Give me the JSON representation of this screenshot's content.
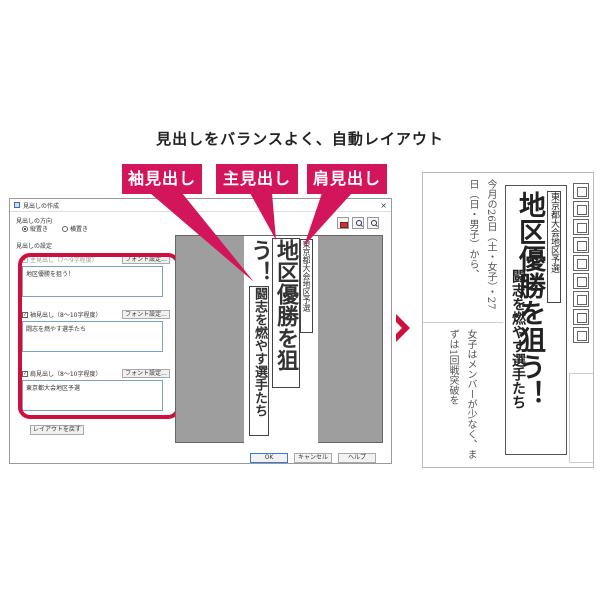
{
  "headline": "見出しをバランスよく、自動レイアウト",
  "tags": {
    "sode": "袖見出し",
    "shu": "主見出し",
    "kata": "肩見出し"
  },
  "dialog": {
    "title": "見出しの作成",
    "close": "×",
    "direction_label": "見出しの方向",
    "radio_vertical": "縦置き",
    "radio_horizontal": "横置き",
    "settings_label": "見出しの設定",
    "main_label": "主見出し（7〜9字程度）",
    "main_value": "地区優勝を狙う！",
    "sode_label": "袖見出し（8〜10字程度）",
    "sode_value": "闘志を燃やす選手たち",
    "kata_label": "肩見出し（8〜10字程度）",
    "kata_value": "東京都大会地区予選",
    "font_button": "フォント設定...",
    "reset_button": "レイアウトを戻す",
    "ok": "OK",
    "cancel": "キャンセル",
    "help": "ヘルプ"
  },
  "preview": {
    "kata": "東京都大会地区予選",
    "shu": "地区優勝を狙う！",
    "sode": "闘志を燃やす選手たち"
  },
  "paper": {
    "kata": "東京都大会地区予選",
    "shu": "地区優勝を狙う！",
    "sode": "闘志を燃やす選手たち",
    "body_top": "今月の26日（土・女子）・27日（日・男子）から、",
    "body_bottom": "女子はメンバーが少なく、まずは1回戦突破を"
  }
}
